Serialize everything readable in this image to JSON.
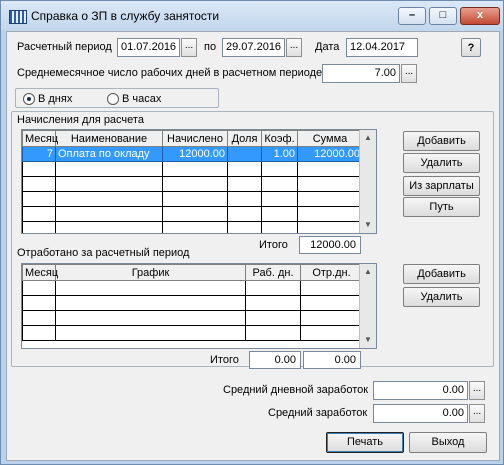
{
  "window": {
    "title": "Справка о ЗП в службу занятости",
    "min": "–",
    "max": "□",
    "close": "x"
  },
  "period": {
    "label": "Расчетный период",
    "from": "01.07.2016",
    "to_label": "по",
    "to": "29.07.2016",
    "date_label": "Дата",
    "date": "12.04.2017",
    "help": "?"
  },
  "avg_days": {
    "label": "Среднемесячное число рабочих дней в расчетном периоде",
    "value": "7.00"
  },
  "mode": {
    "days": "В днях",
    "hours": "В часах",
    "selected": "days"
  },
  "accruals": {
    "title": "Начисления для расчета",
    "columns": [
      "Месяц",
      "Наименование",
      "Начислено",
      "Доля",
      "Коэф.",
      "Сумма"
    ],
    "rows": [
      [
        "7",
        "Оплата по окладу",
        "12000.00",
        "",
        "1.00",
        "12000.00"
      ]
    ],
    "total_label": "Итого",
    "total": "12000.00",
    "buttons": {
      "add": "Добавить",
      "delete": "Удалить",
      "from_salary": "Из зарплаты",
      "path": "Путь"
    }
  },
  "worked": {
    "title": "Отработано за расчетный период",
    "columns": [
      "Месяц",
      "График",
      "Раб. дн.",
      "Отр.дн."
    ],
    "total_label": "Итого",
    "total_work": "0.00",
    "total_done": "0.00",
    "buttons": {
      "add": "Добавить",
      "delete": "Удалить"
    }
  },
  "avg_daily": {
    "label": "Средний дневной заработок",
    "value": "0.00"
  },
  "avg_salary": {
    "label": "Средний заработок",
    "value": "0.00"
  },
  "footer": {
    "print": "Печать",
    "exit": "Выход"
  },
  "dots": "..."
}
